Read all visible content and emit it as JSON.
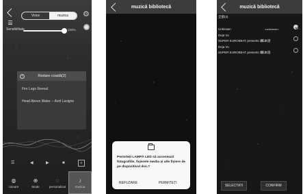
{
  "screen1": {
    "segments": [
      "Voice",
      "muzica"
    ],
    "sensitivity_label": "Sensibilitate",
    "sensitivity_value": "100%",
    "sensitivity_fraction": 1.0,
    "queue_title": "Redare coadă(2)",
    "queue_items": [
      "Fire Logo Reveal",
      "Head Above Water -- Avril Lavigne"
    ],
    "tabs": [
      {
        "label": "culoare",
        "icon": "palette-icon"
      },
      {
        "label": "Mode",
        "icon": "mode-icon"
      },
      {
        "label": "personalizat",
        "icon": "custom-icon"
      },
      {
        "label": "muzica",
        "icon": "music-note-icon"
      }
    ],
    "active_tab": "muzica"
  },
  "screen2": {
    "title": "muzică bibliotecă",
    "dialog_message": "Permiteți LAMPĂ LED să accesează fotografiile, fișierele media și alte fișiere de pe dispozitivul dvs.?",
    "deny_label": "REFUZARE",
    "allow_label": "PERMITEȚI"
  },
  "screen3": {
    "title": "muzică bibliotecă",
    "all_label": "全部(3)",
    "rows": [
      {
        "left": "Unknown",
        "right": "<unknown>",
        "checked": true
      },
      {
        "left": "Deja Vu",
        "right": "",
        "checked": false
      },
      {
        "left": "SUPER EUROBEAT presents 頭 ...",
        "right": "日本語",
        "checked": false
      },
      {
        "left": "Deja Vu",
        "right": "",
        "checked": false
      },
      {
        "left": "SUPER EUROBEAT presents 頭 ...",
        "right": "日本語",
        "checked": false
      }
    ],
    "select_label": "SELECTATI",
    "confirm_label": "CONFIRM"
  }
}
